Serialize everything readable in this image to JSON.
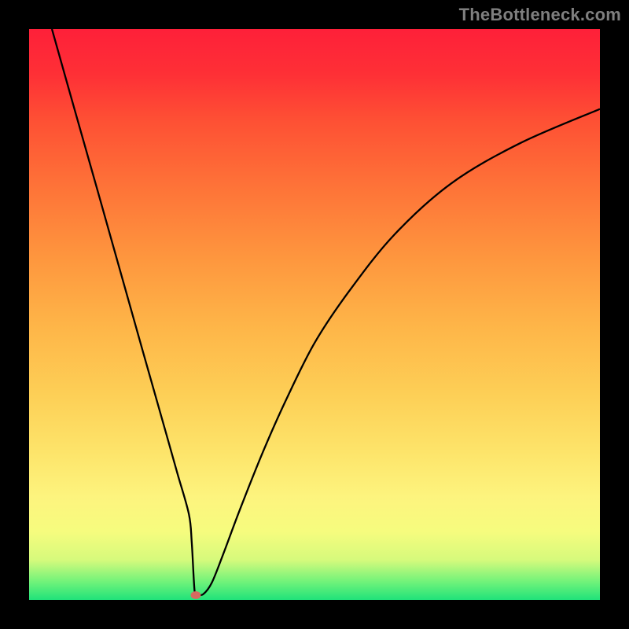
{
  "watermark": "TheBottleneck.com",
  "chart_data": {
    "type": "line",
    "title": "",
    "xlabel": "",
    "ylabel": "",
    "xlim": [
      0,
      100
    ],
    "ylim": [
      0,
      100
    ],
    "grid": false,
    "curve": {
      "x": [
        4,
        8,
        12,
        16,
        20,
        24,
        26,
        28,
        28.5,
        29,
        29.5,
        30.5,
        32,
        34,
        37,
        41,
        45,
        50,
        56,
        64,
        74,
        86,
        100
      ],
      "y": [
        100,
        85.8,
        71.7,
        57.5,
        43.3,
        29.2,
        22.1,
        15.0,
        10.0,
        1.5,
        1.0,
        1.0,
        3.0,
        8.0,
        16.0,
        26.0,
        35.0,
        45.0,
        54.0,
        64.0,
        73.0,
        80.0,
        86.0
      ]
    },
    "minimum_marker": {
      "x": 29.2,
      "y": 0.8,
      "color": "#d56a60"
    },
    "background_gradient": [
      "#fe2039",
      "#fe7438",
      "#fdcf56",
      "#f6fc7e",
      "#20e27a"
    ]
  }
}
